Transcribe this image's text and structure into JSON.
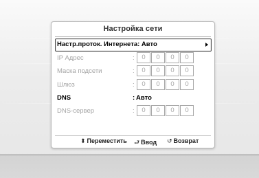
{
  "dialog": {
    "title": "Настройка сети",
    "rows": [
      {
        "label": "Настр.проток. Интернета: Авто",
        "kind": "selector"
      },
      {
        "label": "IP Адрес",
        "colon": ":",
        "octets": [
          "0",
          "0",
          "0",
          "0"
        ],
        "enabled": false
      },
      {
        "label": "Маска подсети",
        "colon": ":",
        "octets": [
          "0",
          "0",
          "0",
          "0"
        ],
        "enabled": false
      },
      {
        "label": "Шлюз",
        "colon": ":",
        "octets": [
          "0",
          "0",
          "0",
          "0"
        ],
        "enabled": false
      },
      {
        "label": "DNS",
        "colon": ":",
        "value": "Авто",
        "enabled": true
      },
      {
        "label": "DNS-сервер",
        "colon": ":",
        "octets": [
          "0",
          "0",
          "0",
          "0"
        ],
        "enabled": false
      }
    ],
    "footer": {
      "move": {
        "icon": "up-down-arrows-icon",
        "glyph": "⬍",
        "label": "Переместить"
      },
      "enter": {
        "icon": "enter-icon",
        "glyph": "⮐",
        "label": "Ввод"
      },
      "back": {
        "icon": "return-icon",
        "glyph": "↺",
        "label": "Возврат"
      }
    }
  },
  "colors": {
    "disabled_text": "#a5a5a5",
    "active_text": "#000000",
    "dialog_bg": "#ffffff",
    "screen_bg": "#ececec"
  }
}
